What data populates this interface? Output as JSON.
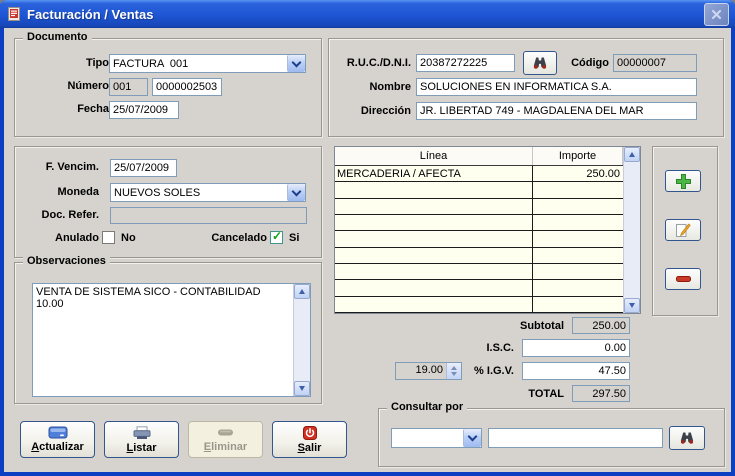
{
  "window": {
    "title": "Facturación / Ventas"
  },
  "documento": {
    "legend": "Documento",
    "tipo_label": "Tipo",
    "tipo_value": "FACTURA  001",
    "numero_label": "Número",
    "numero_serie": "001",
    "numero_value": "0000002503",
    "fecha_label": "Fecha",
    "fecha_value": "25/07/2009"
  },
  "cliente": {
    "ruc_label": "R.U.C./D.N.I.",
    "ruc_value": "20387272225",
    "codigo_label": "Código",
    "codigo_value": "00000007",
    "nombre_label": "Nombre",
    "nombre_value": "SOLUCIONES EN INFORMATICA S.A.",
    "direccion_label": "Dirección",
    "direccion_value": "JR. LIBERTAD 749 - MAGDALENA DEL MAR"
  },
  "detalle": {
    "f_vencim_label": "F. Vencim.",
    "f_vencim_value": "25/07/2009",
    "moneda_label": "Moneda",
    "moneda_value": "NUEVOS SOLES",
    "doc_refer_label": "Doc. Refer.",
    "doc_refer_value": "",
    "anulado_label": "Anulado",
    "anulado_option": "No",
    "anulado_checked": false,
    "cancelado_label": "Cancelado",
    "cancelado_option": "Si",
    "cancelado_checked": true
  },
  "observaciones": {
    "legend": "Observaciones",
    "text": "VENTA DE SISTEMA SICO - CONTABILIDAD 10.00"
  },
  "items_table": {
    "columns": [
      "Línea",
      "Importe"
    ],
    "rows": [
      {
        "linea": "MERCADERIA / AFECTA",
        "importe": "250.00"
      }
    ],
    "empty_rows": 8
  },
  "totales": {
    "subtotal_label": "Subtotal",
    "subtotal_value": "250.00",
    "isc_label": "I.S.C.",
    "isc_value": "0.00",
    "igv_rate": "19.00",
    "igv_label": "% I.G.V.",
    "igv_value": "47.50",
    "total_label": "TOTAL",
    "total_value": "297.50"
  },
  "actions": {
    "actualizar": "Actualizar",
    "listar": "Listar",
    "eliminar": "Eliminar",
    "salir": "Salir"
  },
  "consultar": {
    "legend": "Consultar por",
    "combo_value": "",
    "input_value": ""
  },
  "colors": {
    "titlebar_blue": "#1e55d4",
    "window_bg": "#d6d3ce",
    "field_border": "#7f9db9",
    "table_row_bg": "#fffff0",
    "button_border": "#33568f",
    "accent_green": "#4cb645",
    "accent_red": "#cf3222"
  }
}
